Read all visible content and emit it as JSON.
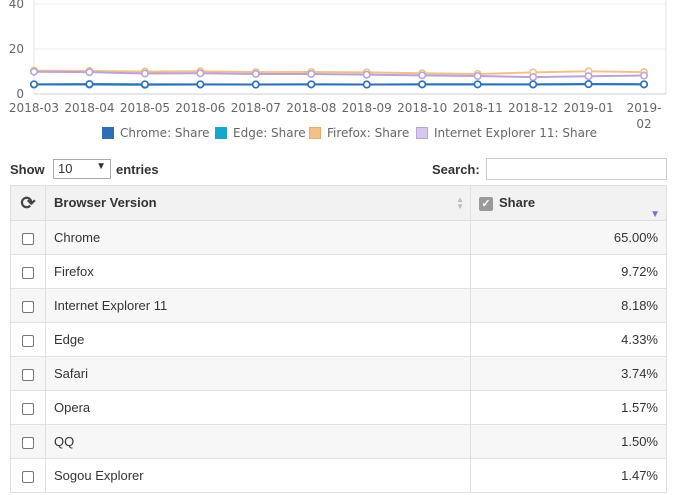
{
  "chart_data": {
    "type": "line",
    "x": [
      "2018-03",
      "2018-04",
      "2018-05",
      "2018-06",
      "2018-07",
      "2018-08",
      "2018-09",
      "2018-10",
      "2018-11",
      "2018-12",
      "2019-01",
      "2019-02"
    ],
    "ylim": [
      0,
      40
    ],
    "yticks": [
      "40",
      "20",
      "0"
    ],
    "series": [
      {
        "name": "Chrome: Share",
        "color": "#2f6db5",
        "values": [
          4.3,
          4.4,
          4.3,
          4.3,
          4.2,
          4.3,
          4.2,
          4.3,
          4.3,
          4.3,
          4.4,
          4.3
        ]
      },
      {
        "name": "Edge: Share",
        "color": "#18a6c9",
        "values": [
          4.2,
          4.2,
          4.1,
          4.2,
          4.2,
          4.3,
          4.2,
          4.3,
          4.3,
          4.2,
          4.4,
          4.3
        ]
      },
      {
        "name": "Firefox: Share",
        "color": "#f3c08c",
        "values": [
          10.4,
          10.2,
          10.0,
          10.1,
          9.7,
          9.8,
          9.6,
          9.2,
          8.9,
          9.6,
          10.1,
          9.7
        ]
      },
      {
        "name": "Internet Explorer 11: Share",
        "color": "#b9a4d8",
        "values": [
          9.9,
          9.7,
          9.1,
          9.2,
          8.9,
          8.9,
          8.6,
          8.3,
          8.0,
          7.5,
          7.9,
          8.2
        ]
      }
    ],
    "grid": "horizontal",
    "legend": "bottom"
  },
  "controls": {
    "show_label": "Show",
    "length_value": "10",
    "entries_label": "entries",
    "search_label": "Search:"
  },
  "table": {
    "col_browser": "Browser Version",
    "col_share": "Share",
    "rows": [
      {
        "name": "Chrome",
        "share": "65.00%"
      },
      {
        "name": "Firefox",
        "share": "9.72%"
      },
      {
        "name": "Internet Explorer 11",
        "share": "8.18%"
      },
      {
        "name": "Edge",
        "share": "4.33%"
      },
      {
        "name": "Safari",
        "share": "3.74%"
      },
      {
        "name": "Opera",
        "share": "1.57%"
      },
      {
        "name": "QQ",
        "share": "1.50%"
      },
      {
        "name": "Sogou Explorer",
        "share": "1.47%"
      }
    ]
  }
}
